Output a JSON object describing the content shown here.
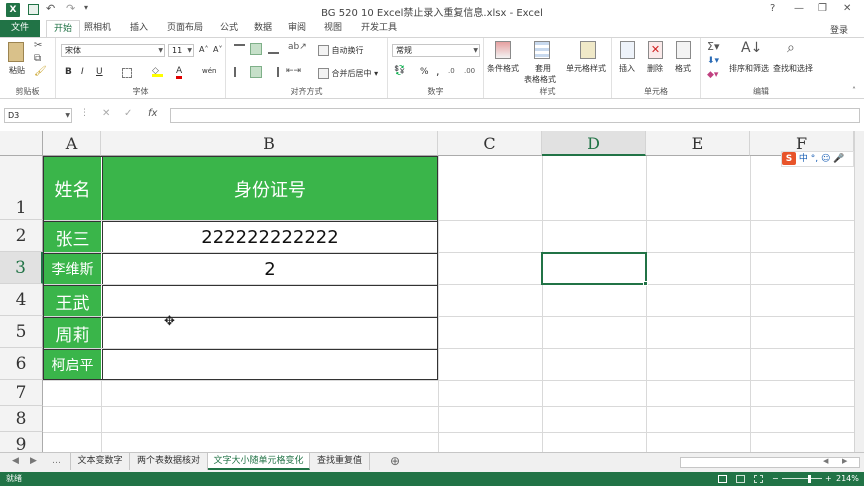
{
  "title": "BG 520 10 Excel禁止录入重复信息.xlsx - Excel",
  "window_controls": {
    "help": "?",
    "minimize": "—",
    "restore": "❐",
    "close": "✕"
  },
  "login": "登录",
  "tabs": [
    "文件",
    "开始",
    "插入",
    "页面布局",
    "公式",
    "数据",
    "审阅",
    "视图",
    "开发工具"
  ],
  "ribbon": {
    "clipboard": {
      "label": "剪贴板",
      "paste": "粘贴"
    },
    "font": {
      "label": "字体",
      "name": "宋体",
      "size": "11",
      "bold": "B",
      "italic": "I",
      "underline": "U",
      "grow": "A˄",
      "shrink": "A˅",
      "font_color": "A",
      "wen": "wén"
    },
    "align": {
      "label": "对齐方式",
      "wrap": "自动换行",
      "merge": "合并后居中"
    },
    "number": {
      "label": "数字",
      "format": "常规",
      "percent": "%",
      "comma": ","
    },
    "styles": {
      "label": "样式",
      "cond": "条件格式",
      "table_1": "套用",
      "table_2": "表格格式",
      "cell": "单元格样式"
    },
    "cells": {
      "label": "单元格",
      "insert": "插入",
      "delete": "删除",
      "format": "格式"
    },
    "edit": {
      "label": "编辑",
      "sort": "排序和筛选",
      "find": "查找和选择"
    }
  },
  "name_box": "D3",
  "fx": "fx",
  "columns": [
    "A",
    "B",
    "C",
    "D",
    "E",
    "F"
  ],
  "rows": [
    "1",
    "2",
    "3",
    "4",
    "5",
    "6",
    "7",
    "8",
    "9"
  ],
  "table": {
    "head_name": "姓名",
    "head_id": "身份证号",
    "names": [
      "张三",
      "李维斯",
      "王武",
      "周莉",
      "柯启平"
    ],
    "ids": [
      "222222222222",
      "2",
      "",
      "",
      ""
    ]
  },
  "sheet_tabs": [
    "文本变数字",
    "两个表数据核对",
    "文字大小随单元格变化",
    "查找重复值"
  ],
  "active_sheet": "文字大小随单元格变化",
  "add_sheet": "⊕",
  "status": {
    "ready": "就绪",
    "zoom": "214%"
  },
  "ime": {
    "logo": "S",
    "items": [
      "中",
      "°,",
      "☺",
      "🎤"
    ]
  },
  "colors": {
    "excel_green": "#217346",
    "cell_green": "#3ab54a",
    "selection": "#217346"
  }
}
